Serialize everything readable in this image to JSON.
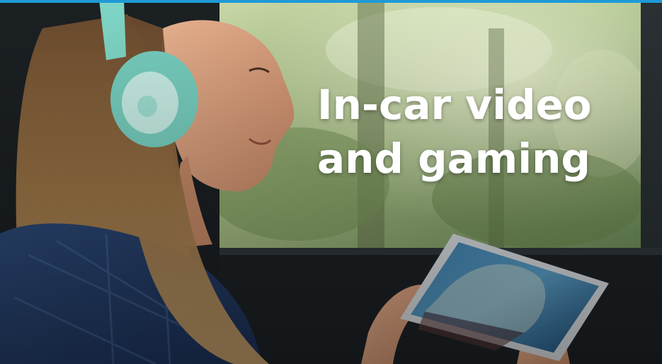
{
  "colors": {
    "accent_bar": "#1e9ad6",
    "headline_text": "#ffffff"
  },
  "headline": {
    "line1": "In-car video",
    "line2": "and gaming"
  }
}
